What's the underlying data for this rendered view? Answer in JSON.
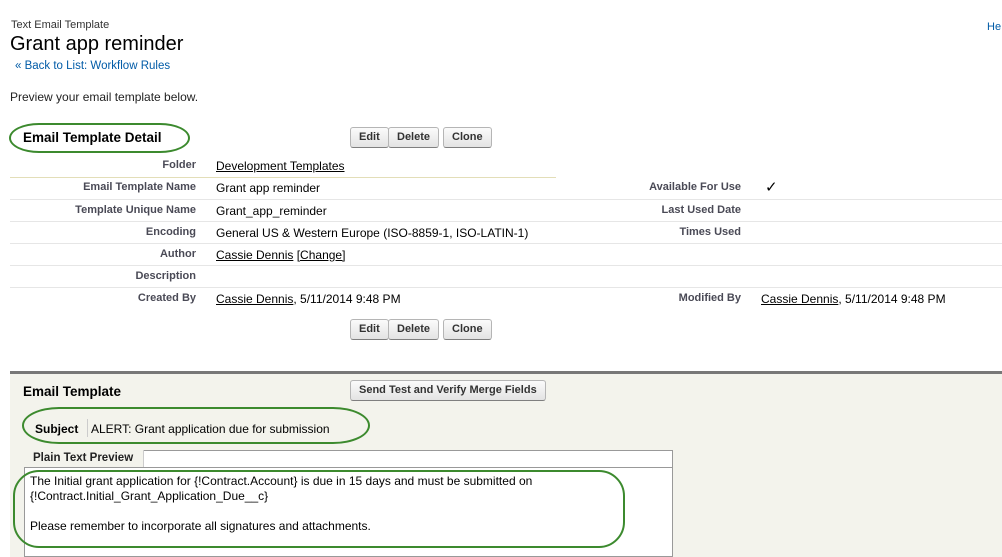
{
  "header": {
    "type_label": "Text Email Template",
    "title": "Grant app reminder",
    "back_link": "« Back to List: Workflow Rules",
    "help_link": "He",
    "preview_message": "Preview your email template below."
  },
  "detail": {
    "section_title": "Email Template Detail",
    "buttons": {
      "edit": "Edit",
      "delete": "Delete",
      "clone": "Clone"
    },
    "fields": {
      "folder": {
        "label": "Folder",
        "value": "Development Templates"
      },
      "name": {
        "label": "Email Template Name",
        "value": "Grant app reminder"
      },
      "unique_name": {
        "label": "Template Unique Name",
        "value": "Grant_app_reminder"
      },
      "encoding": {
        "label": "Encoding",
        "value": "General US & Western Europe (ISO-8859-1, ISO-LATIN-1)"
      },
      "author": {
        "label": "Author",
        "value": "Cassie Dennis",
        "change": "[Change]"
      },
      "description": {
        "label": "Description",
        "value": ""
      },
      "created_by": {
        "label": "Created By",
        "user": "Cassie Dennis",
        "date": ", 5/11/2014 9:48 PM"
      },
      "available": {
        "label": "Available For Use",
        "value": "✓"
      },
      "last_used": {
        "label": "Last Used Date",
        "value": ""
      },
      "times_used": {
        "label": "Times Used",
        "value": ""
      },
      "modified_by": {
        "label": "Modified By",
        "user": "Cassie Dennis",
        "date": ", 5/11/2014 9:48 PM"
      }
    }
  },
  "template": {
    "section_title": "Email Template",
    "send_test_button": "Send Test and Verify Merge Fields",
    "subject_label": "Subject",
    "subject_value": "ALERT: Grant application due for submission",
    "preview_tab": "Plain Text Preview",
    "body_line1": "The Initial grant application for {!Contract.Account} is due in 15 days and must be submitted on",
    "body_line2": "{!Contract.Initial_Grant_Application_Due__c}",
    "body_line3": "Please remember to incorporate all signatures and attachments."
  },
  "colors": {
    "link": "#015ba7",
    "highlight_oval": "#3c8a2e",
    "panel_bg": "#f3f3ec",
    "row_divider": "#e3deb8"
  }
}
